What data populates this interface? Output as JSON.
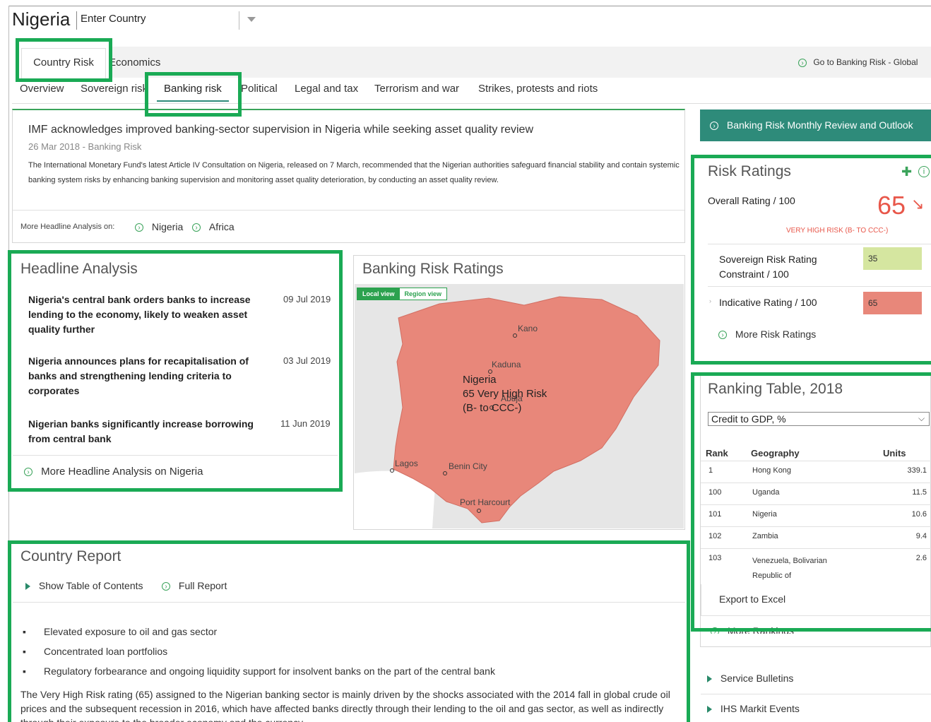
{
  "header": {
    "country": "Nigeria",
    "country_select_placeholder": "Enter Country"
  },
  "main_tabs": [
    {
      "label": "Country Risk"
    },
    {
      "label": "Economics"
    }
  ],
  "top_link": "Go to Banking Risk - Global",
  "sub_tabs": [
    {
      "label": "Overview"
    },
    {
      "label": "Sovereign risk"
    },
    {
      "label": "Banking risk"
    },
    {
      "label": "Political"
    },
    {
      "label": "Legal and tax"
    },
    {
      "label": "Terrorism and war"
    },
    {
      "label": "Strikes, protests and riots"
    }
  ],
  "article": {
    "title": "IMF acknowledges improved banking-sector supervision in Nigeria while seeking asset quality review",
    "meta": "26 Mar 2018 - Banking Risk",
    "body": "The International Monetary Fund's latest Article IV Consultation on Nigeria, released on 7 March, recommended that the Nigerian authorities safeguard financial stability and contain systemic banking system risks by enhancing banking supervision and monitoring asset quality deterioration, by conducting an asset quality review.",
    "more_label": "More Headline Analysis on:",
    "more_links": [
      "Nigeria",
      "Africa"
    ]
  },
  "headline_analysis": {
    "title": "Headline Analysis",
    "items": [
      {
        "text": "Nigeria's central bank orders banks to increase lending to the economy, likely to weaken asset quality further",
        "date": "09 Jul 2019"
      },
      {
        "text": "Nigeria announces plans for recapitalisation of banks and strengthening lending criteria to corporates",
        "date": "03 Jul 2019"
      },
      {
        "text": "Nigerian banks significantly increase borrowing from central bank",
        "date": "11 Jun 2019"
      }
    ],
    "more_link": "More Headline Analysis on Nigeria"
  },
  "map": {
    "title": "Banking Risk Ratings",
    "toggle_local": "Local view",
    "toggle_region": "Region view",
    "country_label": "Nigeria",
    "rating_line": "65 Very High Risk",
    "range_line": "(B- to CCC-)",
    "fill_color": "#e8877a",
    "cities": [
      {
        "name": "Kano"
      },
      {
        "name": "Kaduna"
      },
      {
        "name": "Abuja"
      },
      {
        "name": "Lagos"
      },
      {
        "name": "Benin City"
      },
      {
        "name": "Port Harcourt"
      }
    ]
  },
  "monthly_review_button": "Banking Risk Monthly Review and Outlook",
  "risk_ratings": {
    "title": "Risk Ratings",
    "overall_label": "Overall Rating / 100",
    "overall_value": "65",
    "overall_desc": "VERY HIGH RISK (B- TO CCC-)",
    "rows": [
      {
        "label": "Sovereign Risk Rating Constraint / 100",
        "value": "35",
        "color": "#d5e6a0"
      },
      {
        "label": "Indicative Rating / 100",
        "value": "65",
        "color": "#e8877a"
      }
    ],
    "more_link": "More Risk Ratings"
  },
  "ranking_table": {
    "title": "Ranking Table, 2018",
    "select_value": "Credit to GDP, %",
    "columns": [
      "Rank",
      "Geography",
      "Units"
    ],
    "rows": [
      {
        "rank": "1",
        "geo": "Hong Kong",
        "units": "339.1"
      },
      {
        "rank": "100",
        "geo": "Uganda",
        "units": "11.5"
      },
      {
        "rank": "101",
        "geo": "Nigeria",
        "units": "10.6"
      },
      {
        "rank": "102",
        "geo": "Zambia",
        "units": "9.4"
      },
      {
        "rank": "103",
        "geo": "Venezuela, Bolivarian Republic of",
        "units": "2.6"
      }
    ],
    "export_label": "Export to Excel",
    "more_link": "More Rankings"
  },
  "side_links": [
    "Service Bulletins",
    "IHS Markit Events"
  ],
  "country_report": {
    "title": "Country Report",
    "toc_label": "Show Table of Contents",
    "full_report_label": "Full Report",
    "bullets": [
      "Elevated exposure to oil and gas sector",
      "Concentrated loan portfolios",
      "Regulatory forbearance and ongoing liquidity support for insolvent banks on the part of the central bank"
    ],
    "paragraph": "The Very High Risk rating (65) assigned to the Nigerian banking sector is mainly driven by the shocks associated with the 2014 fall in global crude oil prices and the subsequent recession in 2016, which have affected banks directly through their lending to the oil and gas sector, as well as indirectly through their exposure to the broader economy and the currency."
  },
  "colors": {
    "highlight": "#1aaa55",
    "teal": "#2e8b7a",
    "risk_red": "#e8574a"
  }
}
